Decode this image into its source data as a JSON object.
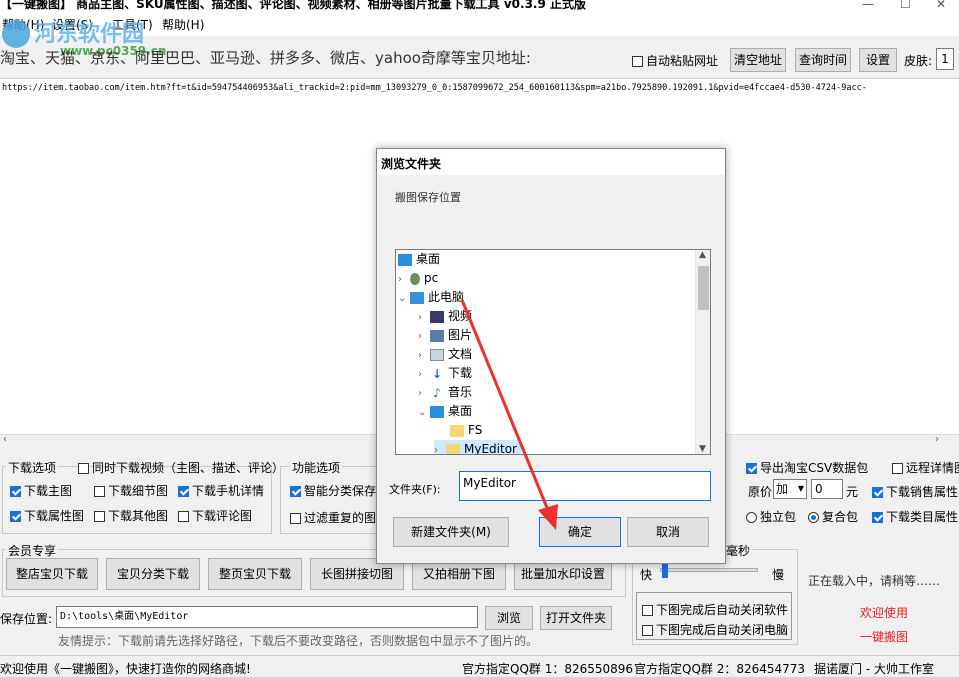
{
  "window": {
    "title": "【一键搬图】 商品主图、SKU属性图、描述图、评论图、视频素材、相册等图片批量下载工具 v0.3.9 正式版",
    "menu": [
      "帮助(H)",
      "设置(S)",
      "工具(T)",
      "帮助(H)"
    ]
  },
  "watermark": {
    "text": "河东软件园",
    "url": "www.pc0359.cn"
  },
  "address": {
    "label": "淘宝、天猫、京东、阿里巴巴、亚马逊、拼多多、微店、yahoo奇摩等宝贝地址:",
    "auto_paste": "自动粘贴网址",
    "clear_btn": "清空地址",
    "time_btn": "查询时间",
    "settings_btn": "设置",
    "skin_label": "皮肤:",
    "skin_value": "1"
  },
  "url_text": "https://item.taobao.com/item.htm?ft=t&id=594754406953&ali_trackid=2:pid=mm_13093279_0_0:1587099672_254_600160113&spm=a21bo.7925890.192091.1&pvid=e4fccae4-d530-4724-9acc-",
  "download_options": {
    "title": "下载选项",
    "sync_video": "同时下载视频（主图、描述、评论）",
    "items": [
      "下载主图",
      "下载细节图",
      "下载手机详情",
      "下载属性图",
      "下载其他图",
      "下载评论图"
    ]
  },
  "function_options": {
    "title": "功能选项",
    "smart": "智能分类保存",
    "filter": "过滤重复的图片"
  },
  "right_options": {
    "export_csv": "导出淘宝CSV数据包",
    "remote_detail": "远程详情图",
    "price_label": "原价",
    "price_op": "加",
    "price_val": "0",
    "price_unit": "元",
    "sales_attr": "下载销售属性",
    "single_pack": "独立包",
    "combo_pack": "复合包",
    "category_attr": "下载类目属性"
  },
  "vip": {
    "title": "会员专享",
    "buttons": [
      "整店宝贝下载",
      "宝贝分类下载",
      "整页宝贝下载",
      "长图拼接切图",
      "又拍相册下图",
      "批量加水印设置"
    ]
  },
  "save": {
    "label": "保存位置:",
    "path": "D:\\tools\\桌面\\MyEditor",
    "browse": "浏览",
    "open_folder": "打开文件夹",
    "tip": "友情提示：下载前请先选择好路径，下载后不要改变路径，否则数据包中显示不了图片的。"
  },
  "speed": {
    "title": "毫秒",
    "fast": "快",
    "slow": "慢",
    "close_software": "下图完成后自动关闭软件",
    "shutdown": "下图完成后自动关闭电脑"
  },
  "status": {
    "loading": "正在载入中，请稍等……",
    "welcome": "欢迎使用",
    "brand": "一键搬图"
  },
  "footer": {
    "left": "欢迎使用《一键搬图》，快速打造你的网络商城!",
    "mid1": "官方指定QQ群 1：826550896",
    "mid2": "官方指定QQ群 2：826454773",
    "right": "据诺厦门 - 大帅工作室"
  },
  "dialog": {
    "title": "浏览文件夹",
    "subtitle": "搬图保存位置",
    "tree": [
      {
        "label": "桌面",
        "icon": "desktop-icon"
      },
      {
        "label": "pc",
        "icon": "user-icon"
      },
      {
        "label": "此电脑",
        "icon": "computer-icon"
      },
      {
        "label": "视频",
        "icon": "video-icon"
      },
      {
        "label": "图片",
        "icon": "picture-icon"
      },
      {
        "label": "文档",
        "icon": "document-icon"
      },
      {
        "label": "下载",
        "icon": "download-icon"
      },
      {
        "label": "音乐",
        "icon": "music-icon"
      },
      {
        "label": "桌面",
        "icon": "desktop-icon"
      },
      {
        "label": "FS",
        "icon": "folder-icon"
      },
      {
        "label": "MyEditor",
        "icon": "folder-icon"
      }
    ],
    "folder_label": "文件夹(F):",
    "folder_value": "MyEditor",
    "new_folder": "新建文件夹(M)",
    "ok": "确定",
    "cancel": "取消"
  },
  "colors": {
    "accent": "#1b6fd8",
    "status_red": "#e02020",
    "arrow": "#e8322e"
  }
}
